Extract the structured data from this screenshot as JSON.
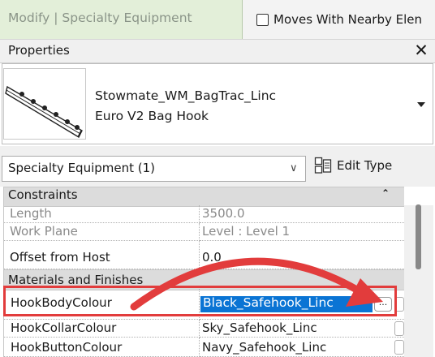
{
  "ribbon": {
    "context_tab": "Modify | Specialty Equipment",
    "moves_with_nearby": {
      "label": "Moves With Nearby Elen",
      "checked": false
    }
  },
  "properties": {
    "title": "Properties",
    "close_icon": "close-icon",
    "type_selector": {
      "family": "Stowmate_WM_BagTrac_Linc",
      "type": "Euro V2 Bag Hook"
    },
    "instance_filter": "Specialty Equipment (1)",
    "edit_type_label": "Edit Type",
    "groups": [
      {
        "label": "Constraints",
        "rows": [
          {
            "name": "Length",
            "value": "3500.0",
            "read_only": true
          },
          {
            "name": "Work Plane",
            "value": "Level : Level 1",
            "read_only": true
          },
          {
            "name": "Offset from Host",
            "value": "0.0",
            "read_only": false
          }
        ]
      },
      {
        "label": "Materials and Finishes",
        "rows": [
          {
            "name": "HookBodyColour",
            "value": "Black_Safehook_Linc",
            "selected": true
          },
          {
            "name": "HookCollarColour",
            "value": "Sky_Safehook_Linc"
          },
          {
            "name": "HookButtonColour",
            "value": "Navy_Safehook_Linc"
          }
        ]
      }
    ]
  },
  "colors": {
    "context_tab_bg": "#e3efd9",
    "selection": "#0a74d4",
    "annotation": "#e23c3c"
  }
}
